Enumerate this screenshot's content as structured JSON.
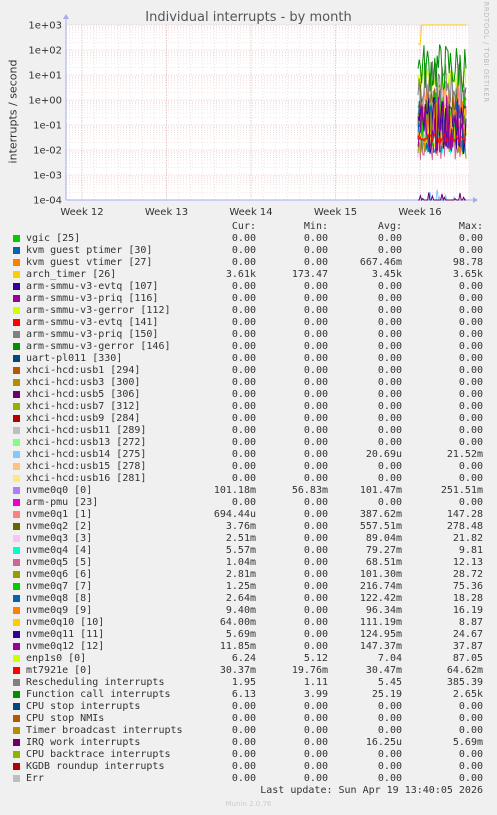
{
  "chart_data": {
    "type": "line",
    "title": "Individual interrupts - by month",
    "ylabel": "interrupts / second",
    "yscale": "log",
    "ylim": [
      0.0001,
      1000
    ],
    "yticks": [
      "1e+03",
      "1e+02",
      "1e+01",
      "1e+00",
      "1e-01",
      "1e-02",
      "1e-03",
      "1e-04"
    ],
    "xticks": [
      "Week 12",
      "Week 13",
      "Week 14",
      "Week 15",
      "Week 16"
    ],
    "side_label": "RRDTOOL / TOBI OETIKER",
    "grid": true,
    "columns": [
      "Cur:",
      "Min:",
      "Avg:",
      "Max:"
    ],
    "series": [
      {
        "name": "vgic [25]",
        "color": "#00cc00",
        "cur": "0.00",
        "min": "0.00",
        "avg": "0.00",
        "max": "0.00"
      },
      {
        "name": "kvm guest ptimer [30]",
        "color": "#0066b3",
        "cur": "0.00",
        "min": "0.00",
        "avg": "0.00",
        "max": "0.00"
      },
      {
        "name": "kvm guest vtimer [27]",
        "color": "#ff8000",
        "cur": "0.00",
        "min": "0.00",
        "avg": "667.46m",
        "max": "98.78"
      },
      {
        "name": "arch_timer [26]",
        "color": "#ffcc00",
        "cur": "3.61k",
        "min": "173.47",
        "avg": "3.45k",
        "max": "3.65k"
      },
      {
        "name": "arm-smmu-v3-evtq [107]",
        "color": "#330099",
        "cur": "0.00",
        "min": "0.00",
        "avg": "0.00",
        "max": "0.00"
      },
      {
        "name": "arm-smmu-v3-priq [116]",
        "color": "#990099",
        "cur": "0.00",
        "min": "0.00",
        "avg": "0.00",
        "max": "0.00"
      },
      {
        "name": "arm-smmu-v3-gerror [112]",
        "color": "#ccff00",
        "cur": "0.00",
        "min": "0.00",
        "avg": "0.00",
        "max": "0.00"
      },
      {
        "name": "arm-smmu-v3-evtq [141]",
        "color": "#ff0000",
        "cur": "0.00",
        "min": "0.00",
        "avg": "0.00",
        "max": "0.00"
      },
      {
        "name": "arm-smmu-v3-priq [150]",
        "color": "#808080",
        "cur": "0.00",
        "min": "0.00",
        "avg": "0.00",
        "max": "0.00"
      },
      {
        "name": "arm-smmu-v3-gerror [146]",
        "color": "#008f00",
        "cur": "0.00",
        "min": "0.00",
        "avg": "0.00",
        "max": "0.00"
      },
      {
        "name": "uart-pl011 [330]",
        "color": "#00487d",
        "cur": "0.00",
        "min": "0.00",
        "avg": "0.00",
        "max": "0.00"
      },
      {
        "name": "xhci-hcd:usb1 [294]",
        "color": "#b35a00",
        "cur": "0.00",
        "min": "0.00",
        "avg": "0.00",
        "max": "0.00"
      },
      {
        "name": "xhci-hcd:usb3 [300]",
        "color": "#b38f00",
        "cur": "0.00",
        "min": "0.00",
        "avg": "0.00",
        "max": "0.00"
      },
      {
        "name": "xhci-hcd:usb5 [306]",
        "color": "#6b006b",
        "cur": "0.00",
        "min": "0.00",
        "avg": "0.00",
        "max": "0.00"
      },
      {
        "name": "xhci-hcd:usb7 [312]",
        "color": "#8fb300",
        "cur": "0.00",
        "min": "0.00",
        "avg": "0.00",
        "max": "0.00"
      },
      {
        "name": "xhci-hcd:usb9 [284]",
        "color": "#b30000",
        "cur": "0.00",
        "min": "0.00",
        "avg": "0.00",
        "max": "0.00"
      },
      {
        "name": "xhci-hcd:usb11 [289]",
        "color": "#bebebe",
        "cur": "0.00",
        "min": "0.00",
        "avg": "0.00",
        "max": "0.00"
      },
      {
        "name": "xhci-hcd:usb13 [272]",
        "color": "#80ff80",
        "cur": "0.00",
        "min": "0.00",
        "avg": "0.00",
        "max": "0.00"
      },
      {
        "name": "xhci-hcd:usb14 [275]",
        "color": "#80c9ff",
        "cur": "0.00",
        "min": "0.00",
        "avg": "20.69u",
        "max": "21.52m"
      },
      {
        "name": "xhci-hcd:usb15 [278]",
        "color": "#ffc080",
        "cur": "0.00",
        "min": "0.00",
        "avg": "0.00",
        "max": "0.00"
      },
      {
        "name": "xhci-hcd:usb16 [281]",
        "color": "#ffe680",
        "cur": "0.00",
        "min": "0.00",
        "avg": "0.00",
        "max": "0.00"
      },
      {
        "name": "nvme0q0 [0]",
        "color": "#aa80ff",
        "cur": "101.18m",
        "min": "56.83m",
        "avg": "101.47m",
        "max": "251.51m"
      },
      {
        "name": "arm-pmu [23]",
        "color": "#ee00cc",
        "cur": "0.00",
        "min": "0.00",
        "avg": "0.00",
        "max": "0.00"
      },
      {
        "name": "nvme0q1 [1]",
        "color": "#ff8080",
        "cur": "694.44u",
        "min": "0.00",
        "avg": "387.62m",
        "max": "147.28"
      },
      {
        "name": "nvme0q2 [2]",
        "color": "#666600",
        "cur": "3.76m",
        "min": "0.00",
        "avg": "557.51m",
        "max": "278.48"
      },
      {
        "name": "nvme0q3 [3]",
        "color": "#ffbfff",
        "cur": "2.51m",
        "min": "0.00",
        "avg": "89.04m",
        "max": "21.82"
      },
      {
        "name": "nvme0q4 [4]",
        "color": "#00ffcc",
        "cur": "5.57m",
        "min": "0.00",
        "avg": "79.27m",
        "max": "9.81"
      },
      {
        "name": "nvme0q5 [5]",
        "color": "#cc6699",
        "cur": "1.04m",
        "min": "0.00",
        "avg": "68.51m",
        "max": "12.13"
      },
      {
        "name": "nvme0q6 [6]",
        "color": "#999900",
        "cur": "2.81m",
        "min": "0.00",
        "avg": "101.30m",
        "max": "28.72"
      },
      {
        "name": "nvme0q7 [7]",
        "color": "#00cc00",
        "cur": "1.25m",
        "min": "0.00",
        "avg": "216.74m",
        "max": "75.36"
      },
      {
        "name": "nvme0q8 [8]",
        "color": "#0066b3",
        "cur": "2.64m",
        "min": "0.00",
        "avg": "122.42m",
        "max": "18.28"
      },
      {
        "name": "nvme0q9 [9]",
        "color": "#ff8000",
        "cur": "9.40m",
        "min": "0.00",
        "avg": "96.34m",
        "max": "16.19"
      },
      {
        "name": "nvme0q10 [10]",
        "color": "#ffcc00",
        "cur": "64.00m",
        "min": "0.00",
        "avg": "111.19m",
        "max": "8.87"
      },
      {
        "name": "nvme0q11 [11]",
        "color": "#330099",
        "cur": "5.69m",
        "min": "0.00",
        "avg": "124.95m",
        "max": "24.67"
      },
      {
        "name": "nvme0q12 [12]",
        "color": "#990099",
        "cur": "11.85m",
        "min": "0.00",
        "avg": "147.37m",
        "max": "37.87"
      },
      {
        "name": "enp1s0 [0]",
        "color": "#ccff00",
        "cur": "6.24",
        "min": "5.12",
        "avg": "7.04",
        "max": "87.05"
      },
      {
        "name": "mt7921e [0]",
        "color": "#ff0000",
        "cur": "30.37m",
        "min": "19.76m",
        "avg": "30.47m",
        "max": "64.62m"
      },
      {
        "name": "Rescheduling interrupts",
        "color": "#808080",
        "cur": "1.95",
        "min": "1.11",
        "avg": "5.45",
        "max": "385.39"
      },
      {
        "name": "Function call interrupts",
        "color": "#008f00",
        "cur": "6.13",
        "min": "3.99",
        "avg": "25.19",
        "max": "2.65k"
      },
      {
        "name": "CPU stop interrupts",
        "color": "#00487d",
        "cur": "0.00",
        "min": "0.00",
        "avg": "0.00",
        "max": "0.00"
      },
      {
        "name": "CPU stop NMIs",
        "color": "#b35a00",
        "cur": "0.00",
        "min": "0.00",
        "avg": "0.00",
        "max": "0.00"
      },
      {
        "name": "Timer broadcast interrupts",
        "color": "#b38f00",
        "cur": "0.00",
        "min": "0.00",
        "avg": "0.00",
        "max": "0.00"
      },
      {
        "name": "IRQ work interrupts",
        "color": "#6b006b",
        "cur": "0.00",
        "min": "0.00",
        "avg": "16.25u",
        "max": "5.69m"
      },
      {
        "name": "CPU backtrace interrupts",
        "color": "#8fb300",
        "cur": "0.00",
        "min": "0.00",
        "avg": "0.00",
        "max": "0.00"
      },
      {
        "name": "KGDB roundup interrupts",
        "color": "#b30000",
        "cur": "0.00",
        "min": "0.00",
        "avg": "0.00",
        "max": "0.00"
      },
      {
        "name": "Err",
        "color": "#bebebe",
        "cur": "0.00",
        "min": "0.00",
        "avg": "0.00",
        "max": "0.00"
      }
    ]
  },
  "last_update": "Last update: Sun Apr 19 13:40:05 2026",
  "footer": "Munin 2.0.76"
}
